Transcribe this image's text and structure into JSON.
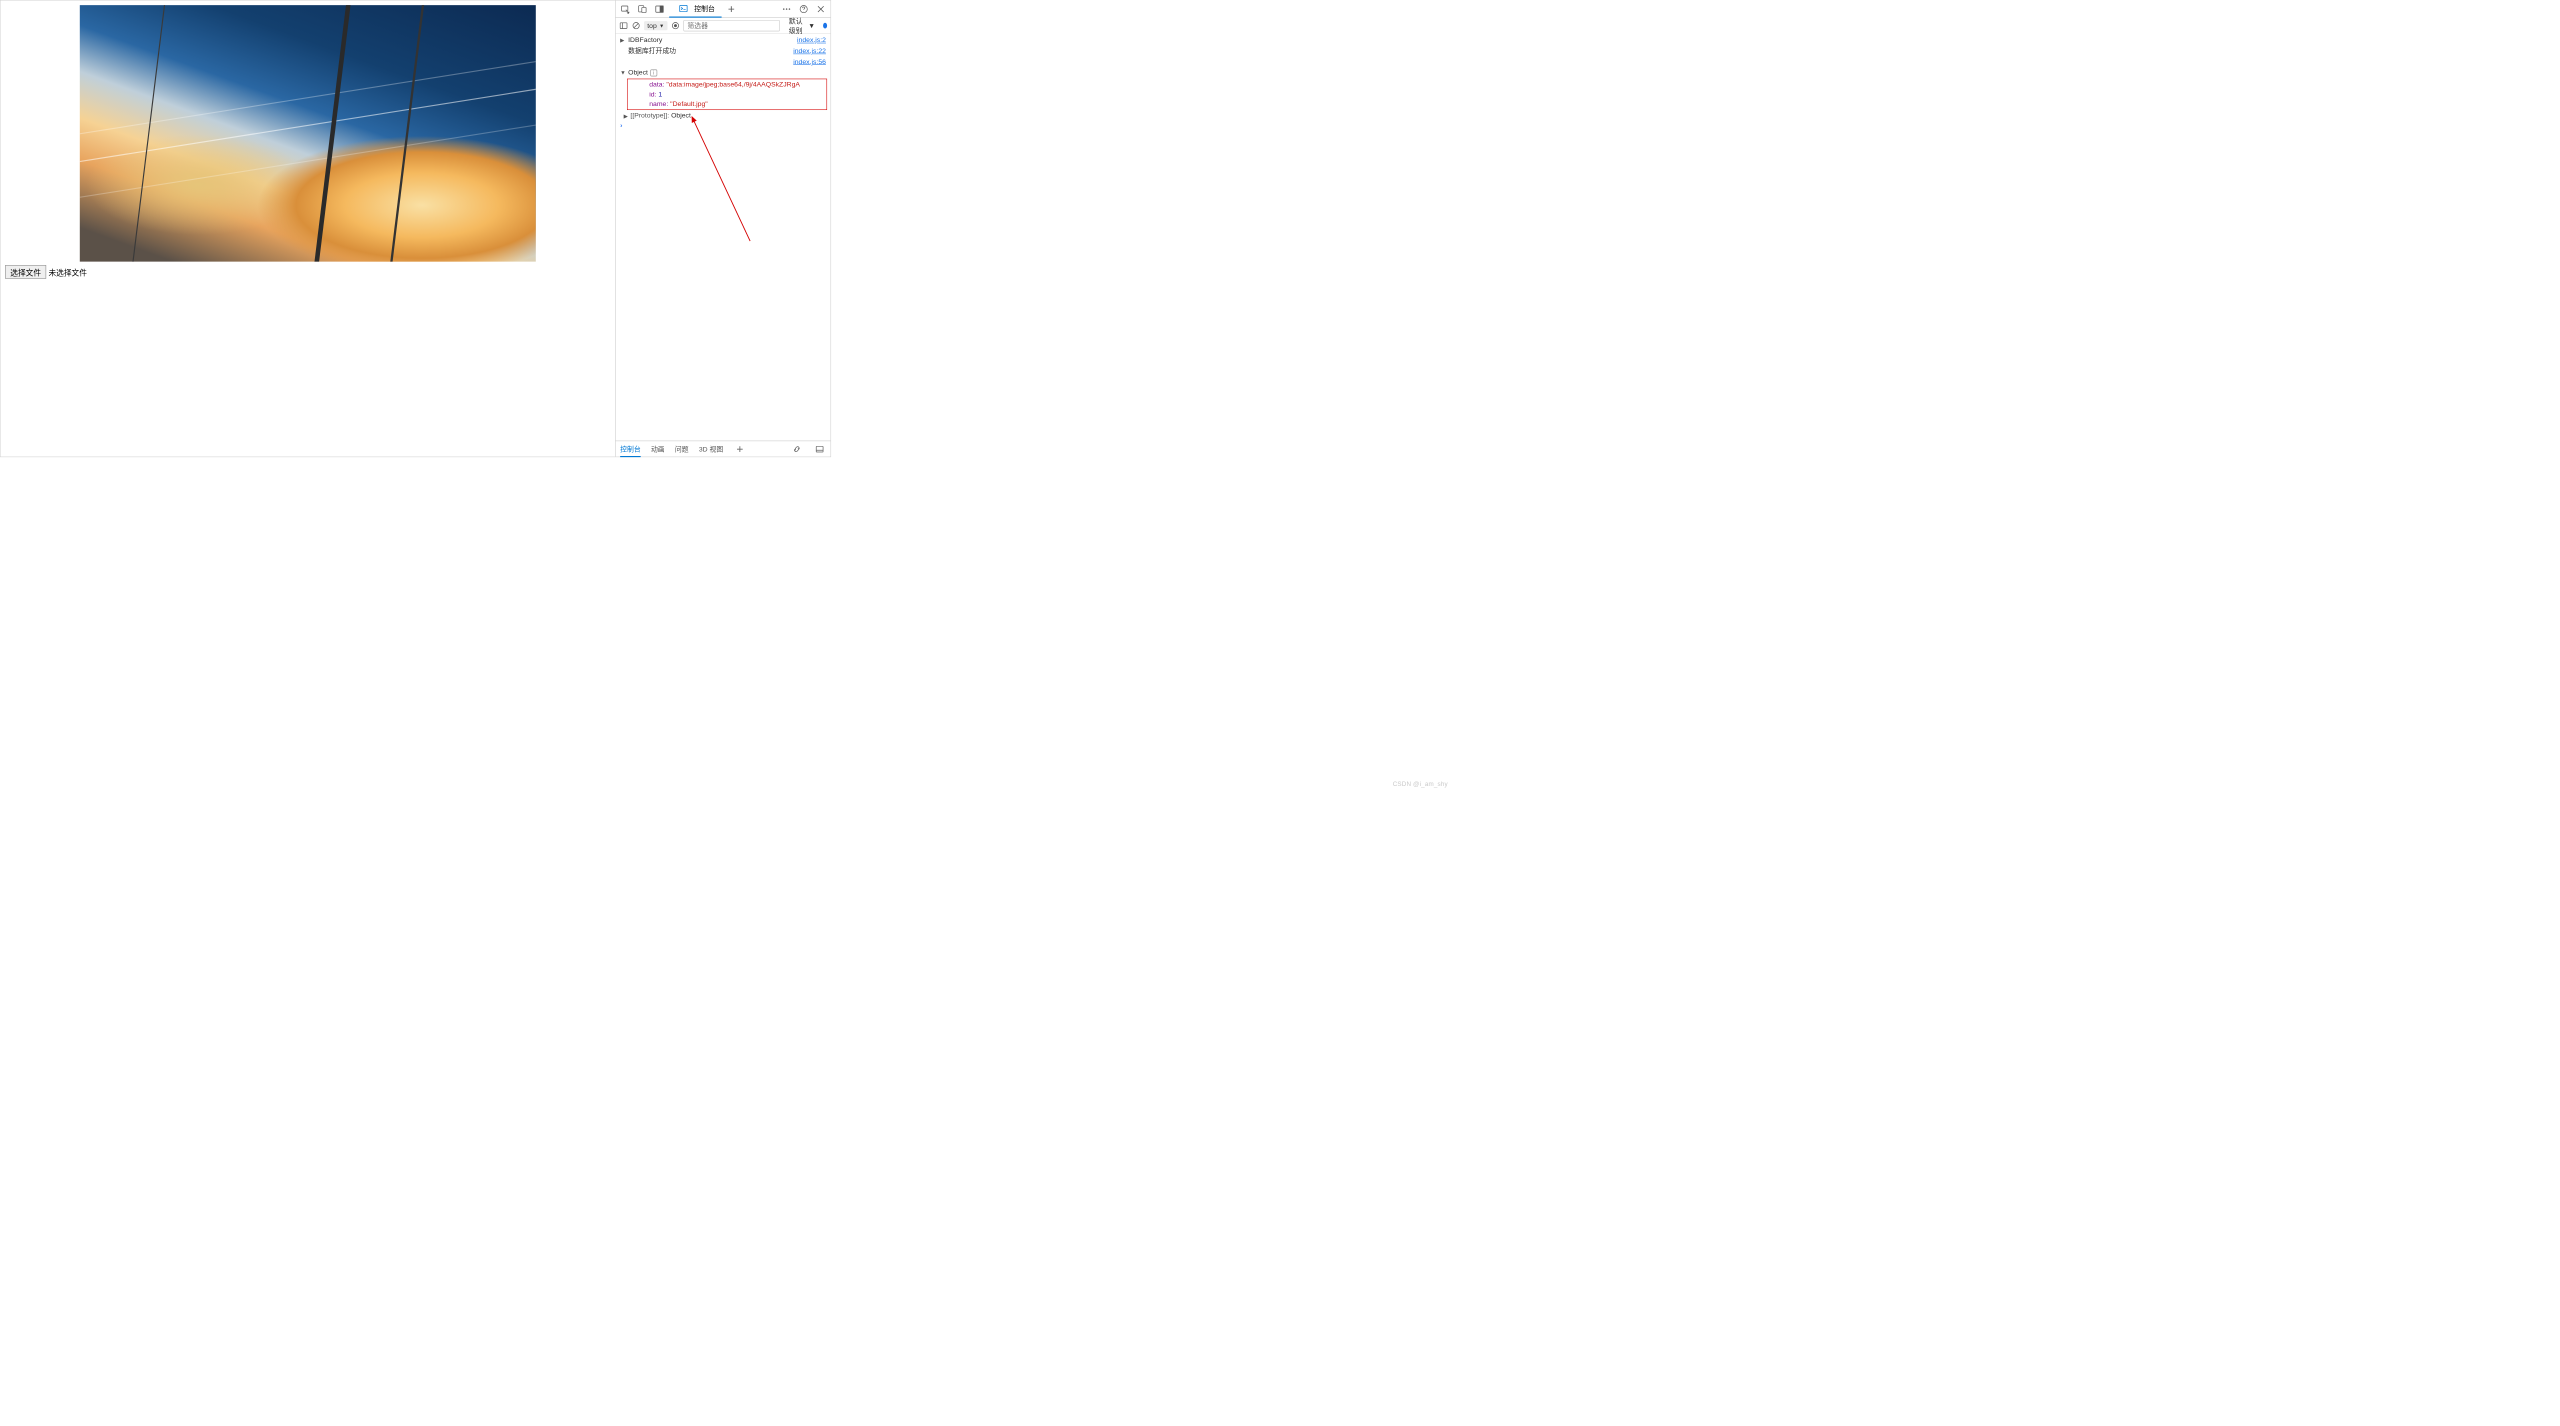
{
  "page": {
    "file_button": "选择文件",
    "file_status": "未选择文件"
  },
  "tabbar": {
    "console_tab": "控制台"
  },
  "toolbar": {
    "context": "top",
    "filter_placeholder": "筛选器",
    "level_label": "默认级别"
  },
  "console": {
    "rows": [
      {
        "disclose": "▶",
        "label": "IDBFactory",
        "src": "index.js:2"
      },
      {
        "text": "数据库打开成功",
        "src": "index.js:22"
      },
      {
        "src": "index.js:56"
      }
    ],
    "object_label": "Object",
    "object_props": {
      "data_key": "data",
      "data_val": "\"data:image/jpeg;base64,/9j/4AAQSkZJRgA",
      "id_key": "id",
      "id_val": "1",
      "name_key": "name",
      "name_val": "\"Default.jpg\""
    },
    "proto_key": "[[Prototype]]",
    "proto_val": "Object"
  },
  "drawer": {
    "tabs": [
      "控制台",
      "动画",
      "问题",
      "3D 视图"
    ]
  },
  "watermark": "CSDN @i_am_shy"
}
